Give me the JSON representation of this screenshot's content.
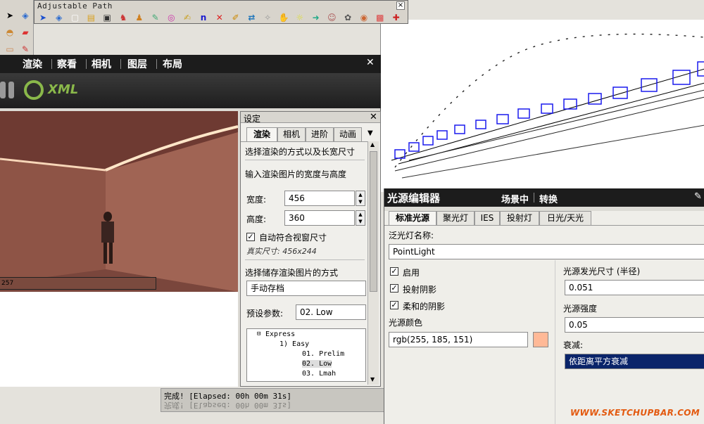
{
  "toolbar": {
    "title": "Adjustable Path",
    "icons": [
      "select-icon",
      "component-icon",
      "new-icon",
      "open-icon",
      "save-icon",
      "walk-icon",
      "figure-icon",
      "pencil-icon",
      "paint-icon",
      "draw-icon",
      "n-icon",
      "delete-icon",
      "brush-icon",
      "swap-icon",
      "light-icon",
      "hand-icon",
      "bulb-icon",
      "arrow-icon",
      "person-icon",
      "paw-icon",
      "target-icon",
      "gift-icon",
      "help-icon"
    ]
  },
  "render_panel": {
    "menu": [
      "渲染",
      "察看",
      "相机",
      "图层",
      "布局"
    ],
    "xml_label": "XML",
    "preview_bar_text": "257"
  },
  "settings": {
    "title": "设定",
    "tabs": [
      "渲染",
      "相机",
      "进阶",
      "动画"
    ],
    "render_method": "选择渲染的方式以及长宽尺寸",
    "size_prompt": "输入渲染图片的宽度与高度",
    "width_label": "宽度:",
    "width_value": "456",
    "height_label": "高度:",
    "height_value": "360",
    "fit_label": "自动符合视窗尺寸",
    "real_size": "真实尺寸: 456x244",
    "save_method": "选择储存渲染图片的方式",
    "save_value": "手动存档",
    "preset_label": "预设参数:",
    "preset_value": "02. Low",
    "tree": [
      "Express",
      "1) Easy",
      "01. Prelim",
      "02. Low",
      "03. Lmah"
    ]
  },
  "status": {
    "line": "完成! [Elapsed: 00h 00m 31s]"
  },
  "light_editor": {
    "title": "光源编辑器",
    "scene_label": "场景中",
    "convert_label": "转换",
    "tabs": [
      "标准光源",
      "聚光灯",
      "IES",
      "投射灯",
      "日光/天光"
    ],
    "name_label": "泛光灯名称:",
    "name_value": "PointLight",
    "enable_label": "启用",
    "shadow_label": "投射阴影",
    "soft_label": "柔和的阴影",
    "color_label": "光源颜色",
    "color_value": "rgb(255, 185, 151)",
    "swatch": "#ffb997",
    "size_label": "光源发光尺寸 (半径)",
    "size_value": "0.051",
    "intensity_label": "光源强度",
    "intensity_value": "0.05",
    "decay_label": "衰减:",
    "decay_value": "依距离平方衰减"
  },
  "watermark": "WWW.SKETCHUPBAR.COM"
}
